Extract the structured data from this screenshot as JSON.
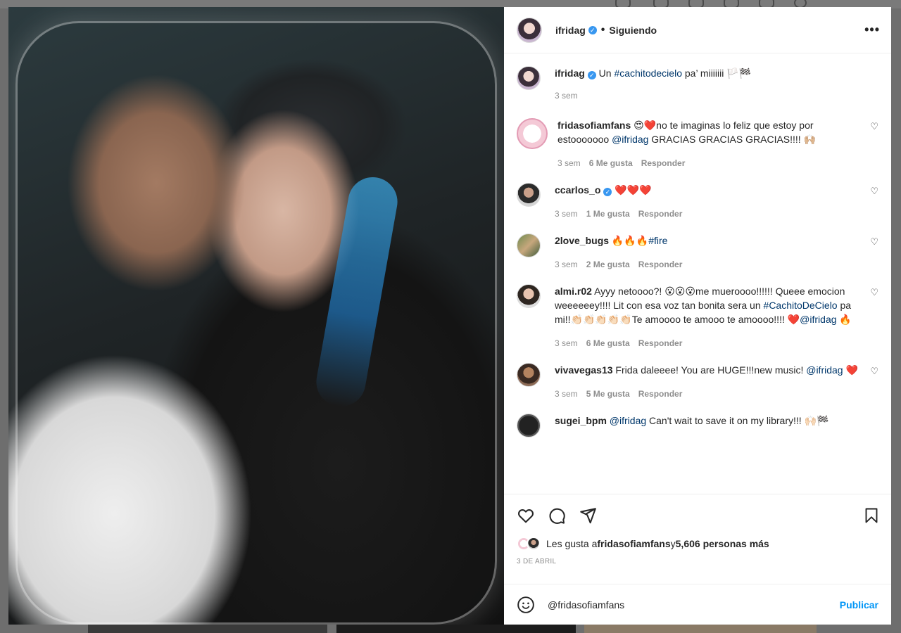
{
  "post": {
    "username": "ifridag",
    "follow_status": "Siguiendo",
    "more_label": "•••"
  },
  "caption": {
    "username": "ifridag",
    "text_before": "Un ",
    "hashtag": "#cachitodecielo",
    "text_after": " pa’ miiiiiii 🏳️🏁",
    "time": "3 sem"
  },
  "comments": [
    {
      "username": "fridasofiamfans",
      "text": "😍❤️no te imaginas lo feliz que estoy por estooooooo ",
      "mention": "@ifridag",
      "text_after": " GRACIAS GRACIAS GRACIAS!!!! 🙌🏼",
      "time": "3 sem",
      "likes": "6 Me gusta",
      "reply": "Responder"
    },
    {
      "username": "ccarlos_o",
      "text": "❤️❤️❤️",
      "time": "3 sem",
      "likes": "1 Me gusta",
      "reply": "Responder"
    },
    {
      "username": "2love_bugs",
      "text": "🔥🔥🔥",
      "hashtag": "#fire",
      "time": "3 sem",
      "likes": "2 Me gusta",
      "reply": "Responder"
    },
    {
      "username": "almi.r02",
      "text": "Ayyy netoooo?! 😮😮😮me mueroooo!!!!!! Queee emocion weeeeeey!!!! Lit con esa voz tan bonita sera un ",
      "hashtag": "#CachitoDeCielo",
      "text_after": " pa mi!!👏🏻👏🏻👏🏻👏🏻👏🏻Te amoooo te amooo te amoooo!!!! ❤️",
      "mention": "@ifridag",
      "text_end": " 🔥",
      "time": "3 sem",
      "likes": "6 Me gusta",
      "reply": "Responder"
    },
    {
      "username": "vivavegas13",
      "text": "Frida daleeee! You are HUGE!!!new music! ",
      "mention": "@ifridag",
      "text_after": " ❤️",
      "time": "3 sem",
      "likes": "5 Me gusta",
      "reply": "Responder"
    },
    {
      "username": "sugei_bpm",
      "mention": "@ifridag",
      "text": " Can't wait to save it on my library!!! 🙌🏻🏁"
    }
  ],
  "likes_summary": {
    "prefix": "Les gusta a ",
    "user": "fridasofiamfans",
    "middle": " y ",
    "count": "5,606 personas más"
  },
  "date": "3 DE ABRIL",
  "composer": {
    "value": "@fridasofiamfans",
    "publish": "Publicar"
  }
}
